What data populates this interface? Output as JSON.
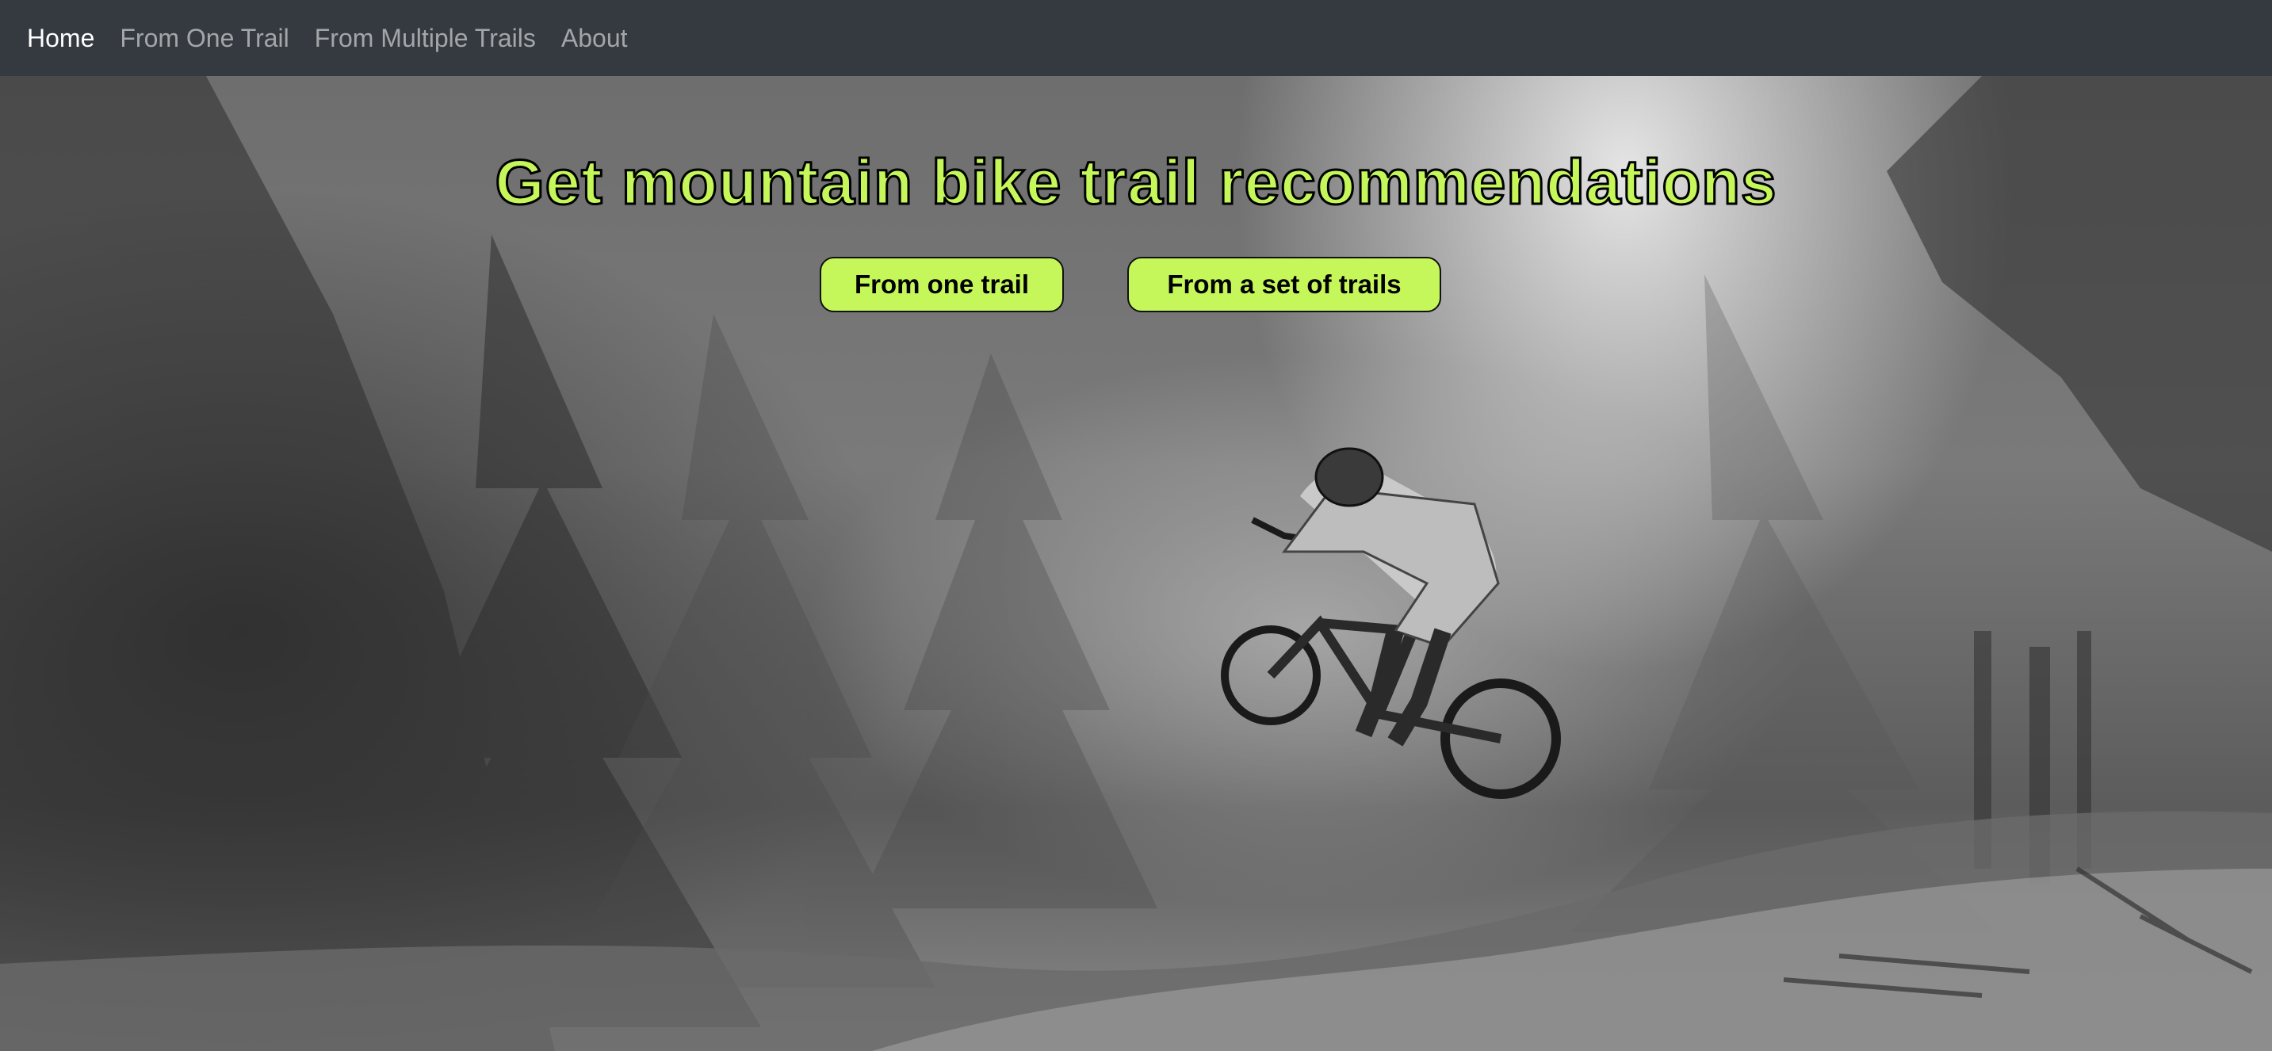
{
  "navbar": {
    "items": [
      {
        "label": "Home",
        "active": true
      },
      {
        "label": "From One Trail",
        "active": false
      },
      {
        "label": "From Multiple Trails",
        "active": false
      },
      {
        "label": "About",
        "active": false
      }
    ]
  },
  "hero": {
    "title": "Get mountain bike trail recommendations",
    "buttons": {
      "one_trail": "From one trail",
      "set_of_trails": "From a set of trails"
    },
    "background_image": "grayscale-forest-mountain-biker-jump"
  },
  "colors": {
    "navbar_bg": "#343a40",
    "accent": "#c5f75a",
    "nav_active": "#ffffff",
    "nav_inactive": "rgba(255,255,255,0.55)"
  }
}
